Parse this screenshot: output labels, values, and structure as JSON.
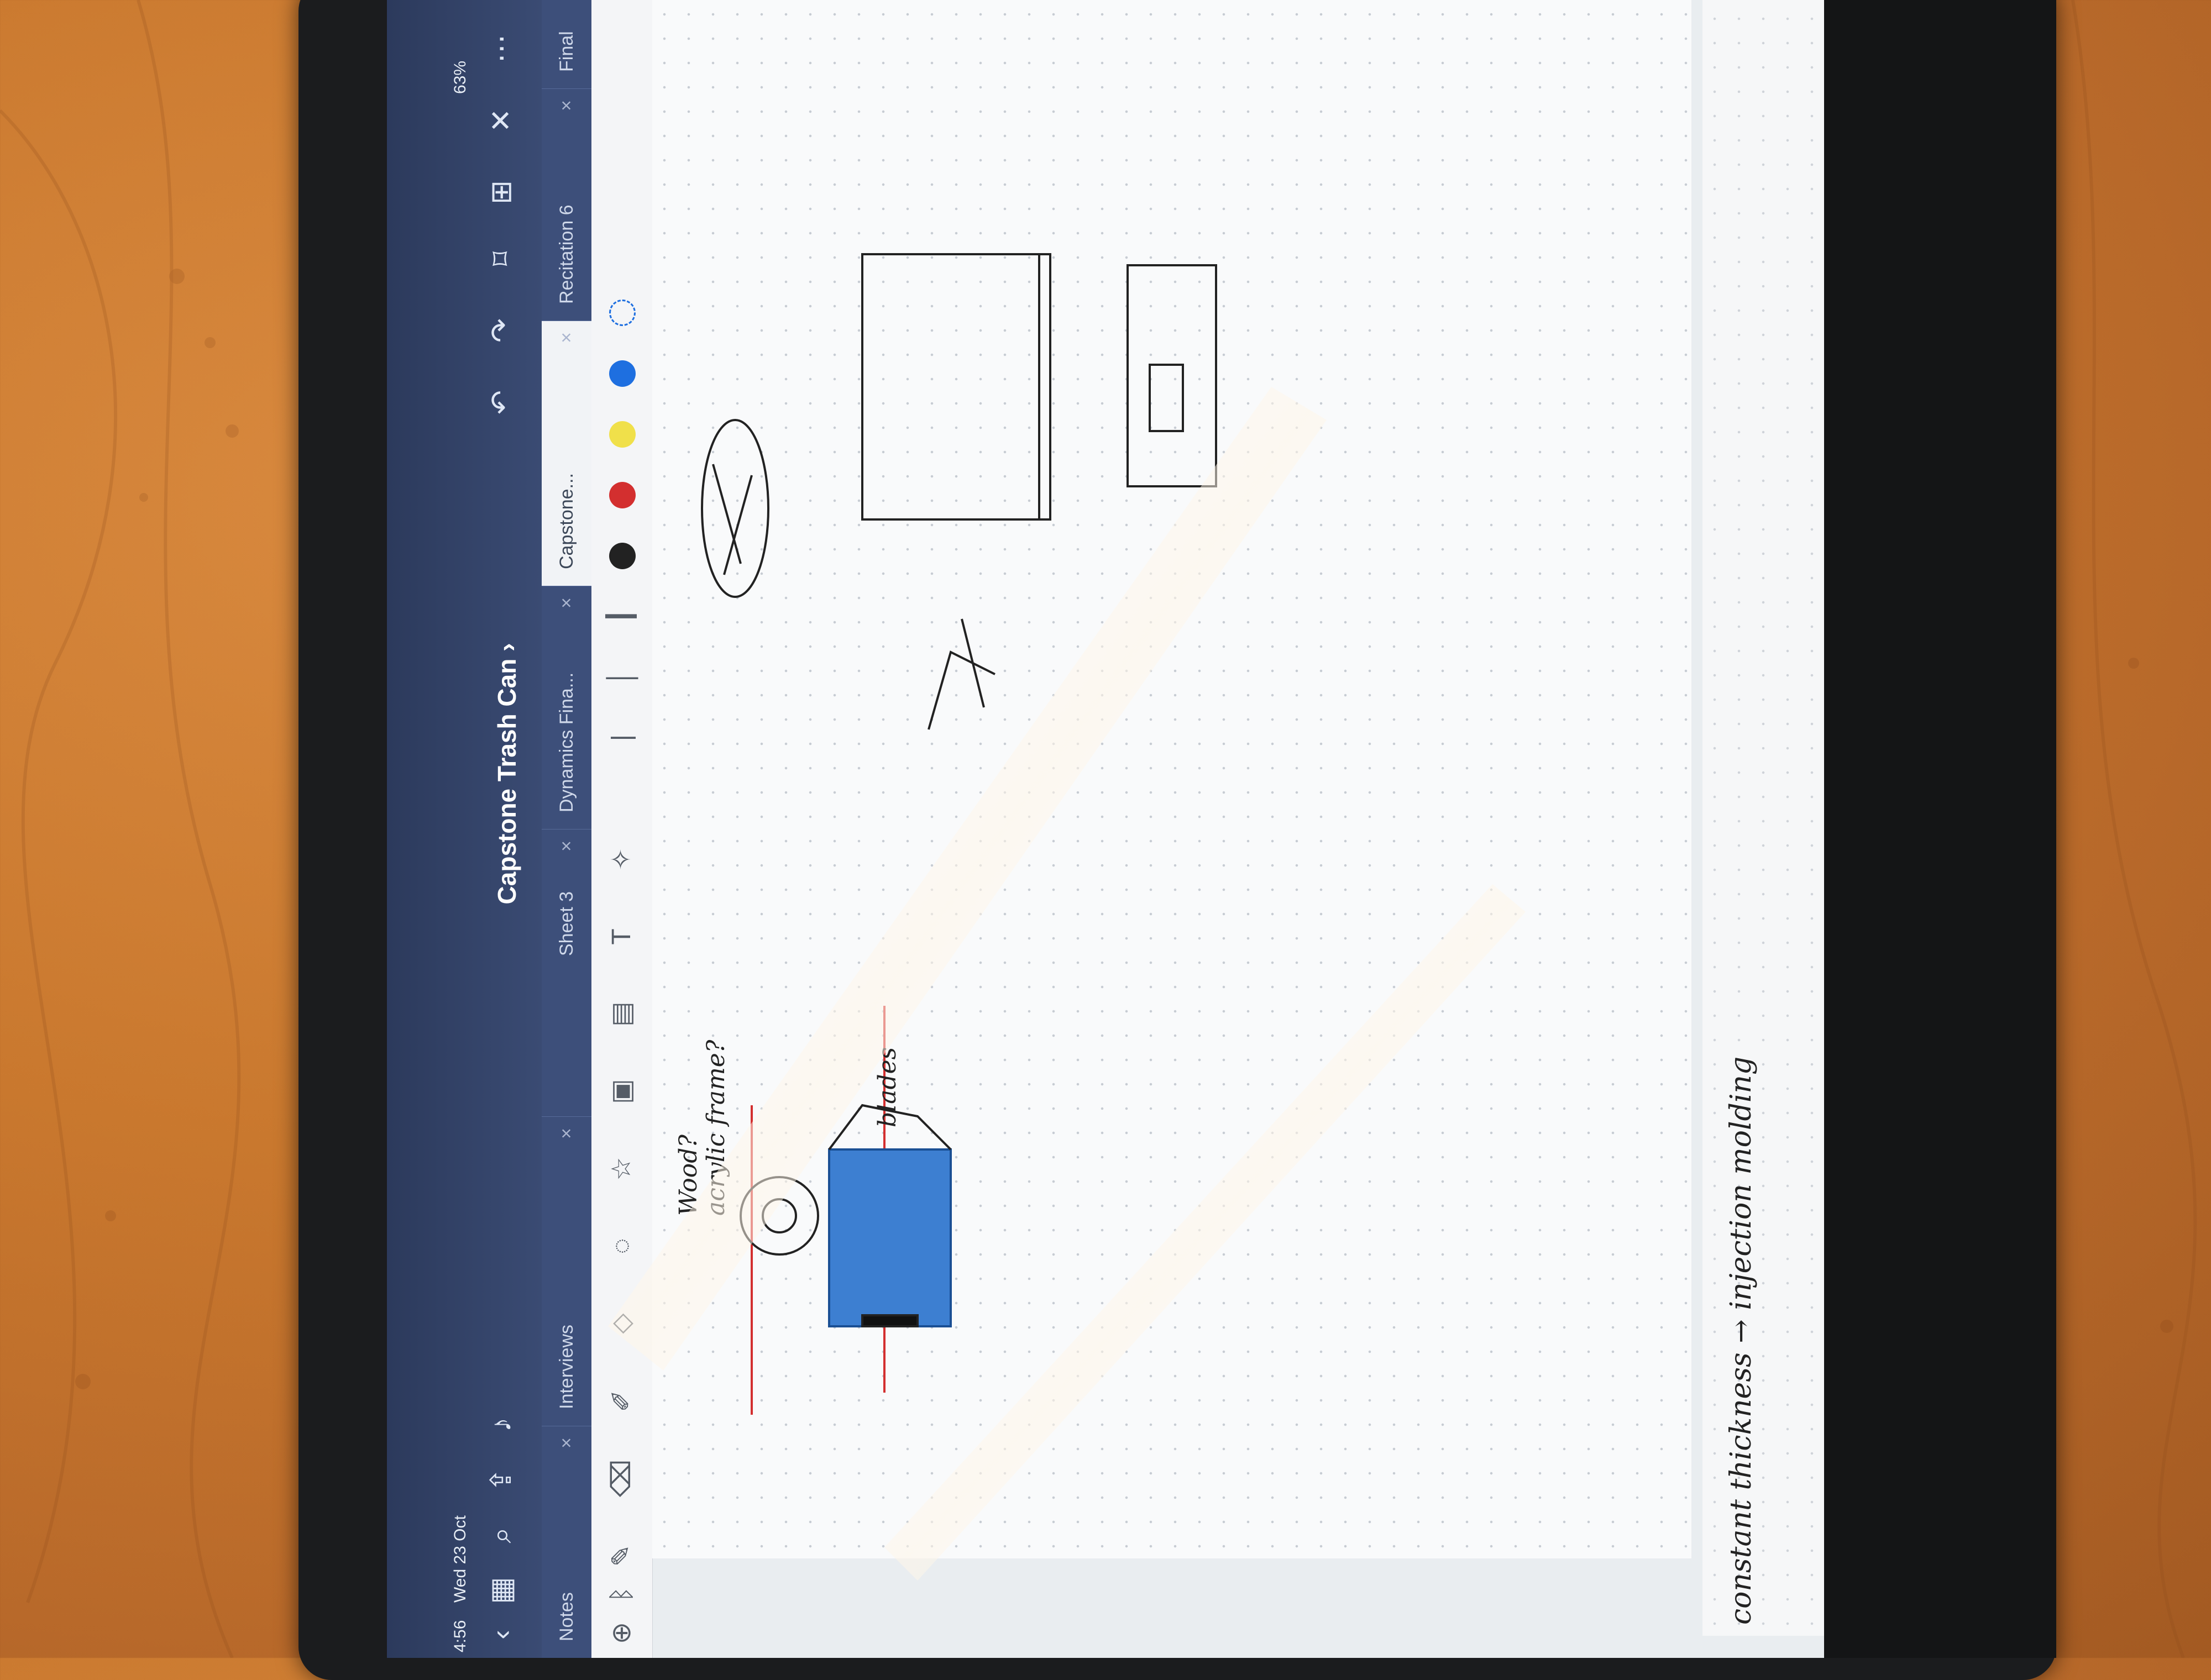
{
  "status_bar": {
    "time": "4:56",
    "date": "Wed 23 Oct",
    "battery": "63%"
  },
  "header": {
    "title": "Capstone Trash Can",
    "title_chevron": "›"
  },
  "tabs": [
    {
      "label": "Notes"
    },
    {
      "label": "Interviews"
    },
    {
      "label": "Sheet 3"
    },
    {
      "label": "Dynamics Fina..."
    },
    {
      "label": "Capstone..."
    },
    {
      "label": "Recitation 6"
    },
    {
      "label": "Final Cheat S"
    }
  ],
  "annotations": {
    "wood": "Wood?",
    "acrylic": "acrylic frame?",
    "blades": "blades",
    "bottom_note": "constant thickness → injection molding"
  },
  "colors": {
    "pen_black": "#222222",
    "red": "#d32f2f",
    "yellow": "#f0e04a",
    "blue": "#1e6fe0"
  }
}
